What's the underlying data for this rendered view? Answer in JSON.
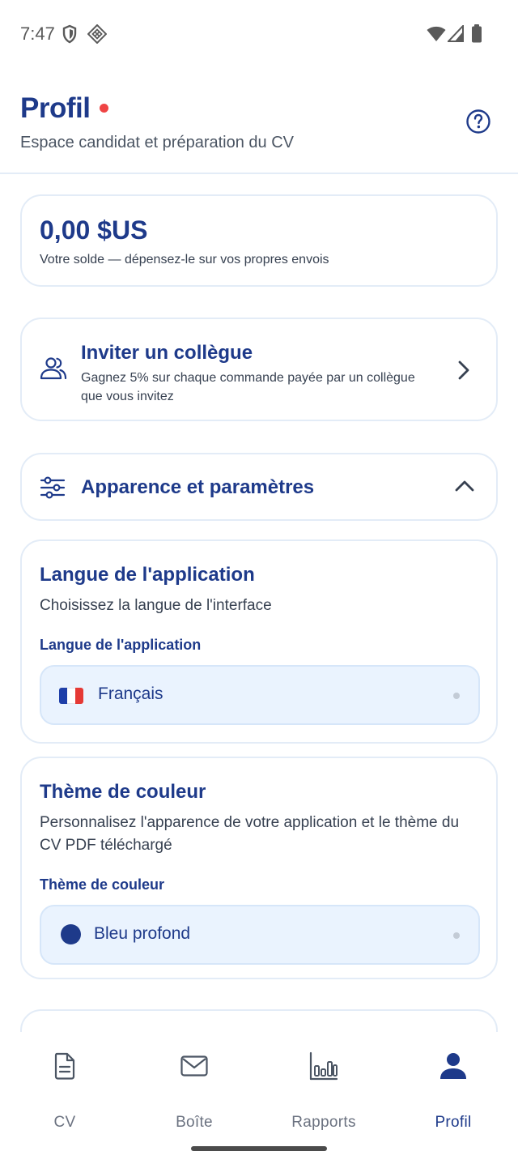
{
  "status_bar": {
    "time": "7:47",
    "left_icons": [
      "shield-icon",
      "diamond-grid-icon"
    ],
    "right_icons": [
      "wifi-icon",
      "signal-icon",
      "battery-icon"
    ]
  },
  "header": {
    "title": "Profil",
    "subtitle": "Espace candidat et préparation du CV",
    "help_icon": "help-circle-icon",
    "notification_dot_color": "#ef4444"
  },
  "balance": {
    "amount": "0,00 $US",
    "description": "Votre solde — dépensez-le sur vos propres envois"
  },
  "invite": {
    "icon": "users-icon",
    "title": "Inviter un collègue",
    "description": "Gagnez 5% sur chaque commande payée par un collègue que vous invitez"
  },
  "settings_section": {
    "icon": "sliders-icon",
    "title": "Apparence et paramètres",
    "expanded": true
  },
  "language": {
    "title": "Langue de l'application",
    "description": "Choisissez la langue de l'interface",
    "field_label": "Langue de l'application",
    "selected": "Français",
    "flag": "french-flag"
  },
  "theme": {
    "title": "Thème de couleur",
    "description": "Personnalisez l'apparence de votre application et le thème du CV PDF téléchargé",
    "field_label": "Thème de couleur",
    "selected": "Bleu profond",
    "swatch_color": "#1e3a8a"
  },
  "bottom_nav": {
    "items": [
      {
        "label": "CV",
        "icon": "document-icon",
        "active": false
      },
      {
        "label": "Boîte",
        "icon": "mail-icon",
        "active": false
      },
      {
        "label": "Rapports",
        "icon": "bar-chart-icon",
        "active": false
      },
      {
        "label": "Profil",
        "icon": "user-icon",
        "active": true
      }
    ]
  },
  "colors": {
    "primary": "#1e3a8a",
    "card_border": "#e3ecf7",
    "select_bg": "#eaf3fe",
    "muted_text": "#6b7280"
  }
}
